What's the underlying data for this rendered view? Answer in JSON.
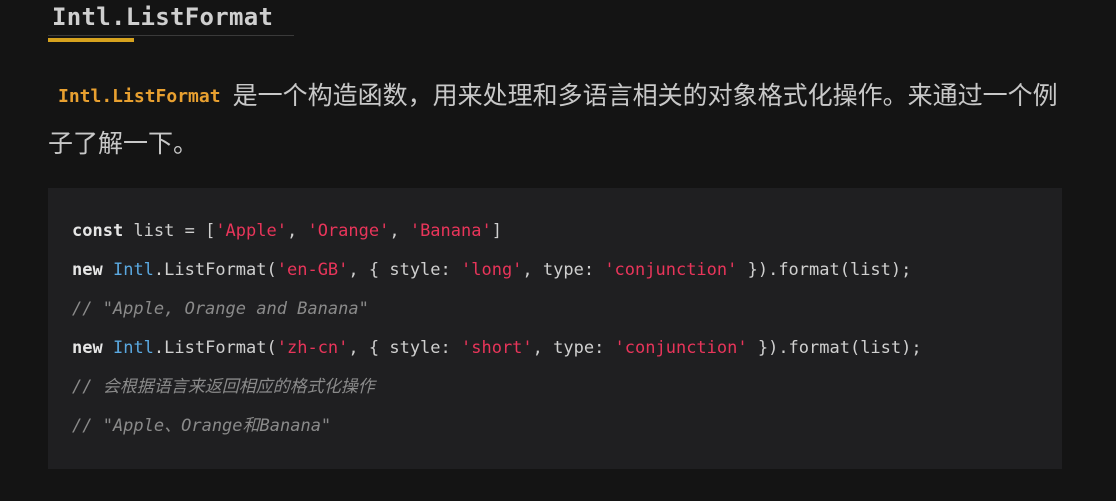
{
  "heading": "Intl.ListFormat",
  "intro": {
    "code": "Intl.ListFormat",
    "text": "是一个构造函数，用来处理和多语言相关的对象格式化操作。来通过一个例子了解一下。"
  },
  "code": {
    "line1": {
      "keyword": "const",
      "rest": " list = [",
      "s1": "'Apple'",
      "sep1": ", ",
      "s2": "'Orange'",
      "sep2": ", ",
      "s3": "'Banana'",
      "end": "]"
    },
    "line2": {
      "keyword": "new",
      "cls": "Intl",
      "call": ".ListFormat(",
      "locale": "'en-GB'",
      "mid1": ", { style: ",
      "style": "'long'",
      "mid2": ", type: ",
      "type": "'conjunction'",
      "end": " }).format(list);"
    },
    "line3": "// \"Apple, Orange and Banana\"",
    "line4": {
      "keyword": "new",
      "cls": "Intl",
      "call": ".ListFormat(",
      "locale": "'zh-cn'",
      "mid1": ", { style: ",
      "style": "'short'",
      "mid2": ", type: ",
      "type": "'conjunction'",
      "end": " }).format(list);"
    },
    "line5": "// 会根据语言来返回相应的格式化操作",
    "line6": "// \"Apple、Orange和Banana\""
  },
  "colors": {
    "background": "#141414",
    "code_background": "#1f1f21",
    "heading_accent": "#d6a21e",
    "inline_code": "#e8a030",
    "string": "#e8355a",
    "class_name": "#5aa8e0",
    "comment": "#8a8a8a"
  }
}
